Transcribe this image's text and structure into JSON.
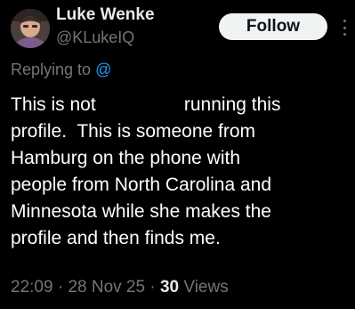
{
  "author": {
    "display_name": "Luke Wenke",
    "handle": "@KLukeIQ",
    "avatar_icon": "profile-photo"
  },
  "follow_button": {
    "label": "Follow"
  },
  "more_menu": {
    "icon": "more-vertical-icon"
  },
  "reply": {
    "prefix": "Replying to ",
    "mention": "@"
  },
  "tweet": {
    "lines": [
      "This is not                 running this",
      "profile.  This is someone from",
      "Hamburg on the phone with",
      "people from North Carolina and",
      "Minnesota while she makes the",
      "profile and then finds me."
    ]
  },
  "meta": {
    "time": "22:09",
    "separator": " · ",
    "date": "28 Nov 25",
    "views_count": "30",
    "views_label": " Views"
  },
  "colors": {
    "background": "#000000",
    "primary_text": "#e7e9ea",
    "secondary_text": "#71767b",
    "link": "#1d9bf0",
    "button_bg": "#eff3f4"
  }
}
